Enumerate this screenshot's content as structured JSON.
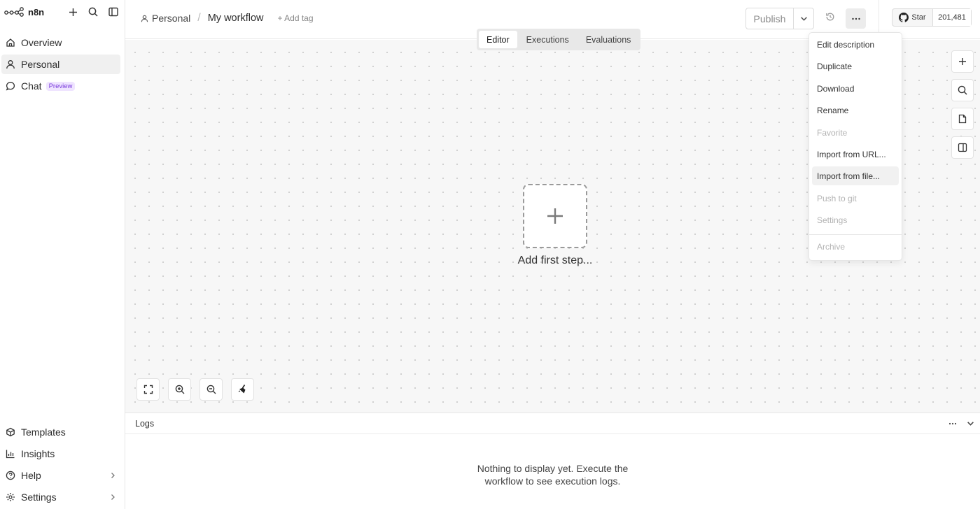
{
  "app": {
    "name": "n8n"
  },
  "sidebar": {
    "items": [
      {
        "label": "Overview",
        "icon": "home-icon"
      },
      {
        "label": "Personal",
        "icon": "user-icon"
      },
      {
        "label": "Chat",
        "icon": "chat-icon",
        "badge": "Preview"
      }
    ],
    "bottom": [
      {
        "label": "Templates",
        "icon": "templates-icon"
      },
      {
        "label": "Insights",
        "icon": "insights-icon"
      },
      {
        "label": "Help",
        "icon": "help-icon"
      },
      {
        "label": "Settings",
        "icon": "settings-icon"
      }
    ]
  },
  "header": {
    "breadcrumb_project": "Personal",
    "breadcrumb_sep": "/",
    "workflow_name": "My workflow",
    "add_tag": "+ Add tag",
    "publish_label": "Publish",
    "github_star": "Star",
    "github_count": "201,481"
  },
  "canvas": {
    "tabs": [
      "Editor",
      "Executions",
      "Evaluations"
    ],
    "active_tab": "Editor",
    "add_first_step": "Add first step..."
  },
  "menu": {
    "items": [
      {
        "label": "Edit description",
        "disabled": false
      },
      {
        "label": "Duplicate",
        "disabled": false
      },
      {
        "label": "Download",
        "disabled": false
      },
      {
        "label": "Rename",
        "disabled": false
      },
      {
        "label": "Favorite",
        "disabled": true
      },
      {
        "label": "Import from URL...",
        "disabled": false
      },
      {
        "label": "Import from file...",
        "disabled": false,
        "hovered": true
      },
      {
        "label": "Push to git",
        "disabled": true
      },
      {
        "label": "Settings",
        "disabled": true
      },
      {
        "label": "Archive",
        "disabled": true
      }
    ]
  },
  "logs": {
    "title": "Logs",
    "empty_line1": "Nothing to display yet. Execute the",
    "empty_line2": "workflow to see execution logs."
  },
  "colors": {
    "accent_badge": "#7a3cdc",
    "canvas_bg": "#f7f7f7"
  }
}
